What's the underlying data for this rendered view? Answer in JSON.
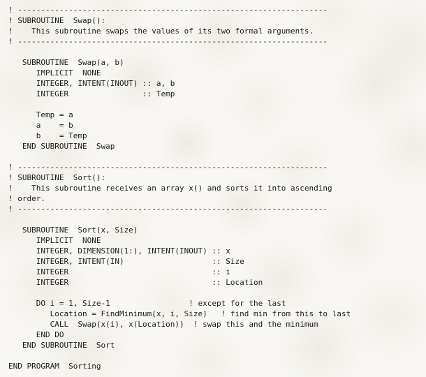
{
  "document": {
    "kind": "fortran-source-listing",
    "program_name": "Sorting",
    "background_color": "#f8f7f3",
    "text_color": "#1c1c1c"
  },
  "code": {
    "lines": [
      "! -------------------------------------------------------------------",
      "! SUBROUTINE  Swap():",
      "!    This subroutine swaps the values of its two formal arguments.",
      "! -------------------------------------------------------------------",
      "",
      "   SUBROUTINE  Swap(a, b)",
      "      IMPLICIT  NONE",
      "      INTEGER, INTENT(INOUT) :: a, b",
      "      INTEGER                :: Temp",
      "",
      "      Temp = a",
      "      a    = b",
      "      b    = Temp",
      "   END SUBROUTINE  Swap",
      "",
      "! -------------------------------------------------------------------",
      "! SUBROUTINE  Sort():",
      "!    This subroutine receives an array x() and sorts it into ascending",
      "! order.",
      "! -------------------------------------------------------------------",
      "",
      "   SUBROUTINE  Sort(x, Size)",
      "      IMPLICIT  NONE",
      "      INTEGER, DIMENSION(1:), INTENT(INOUT) :: x",
      "      INTEGER, INTENT(IN)                   :: Size",
      "      INTEGER                               :: i",
      "      INTEGER                               :: Location",
      "",
      "      DO i = 1, Size-1                 ! except for the last",
      "         Location = FindMinimum(x, i, Size)   ! find min from this to last",
      "         CALL  Swap(x(i), x(Location))  ! swap this and the minimum",
      "      END DO",
      "   END SUBROUTINE  Sort",
      "",
      "END PROGRAM  Sorting"
    ]
  }
}
